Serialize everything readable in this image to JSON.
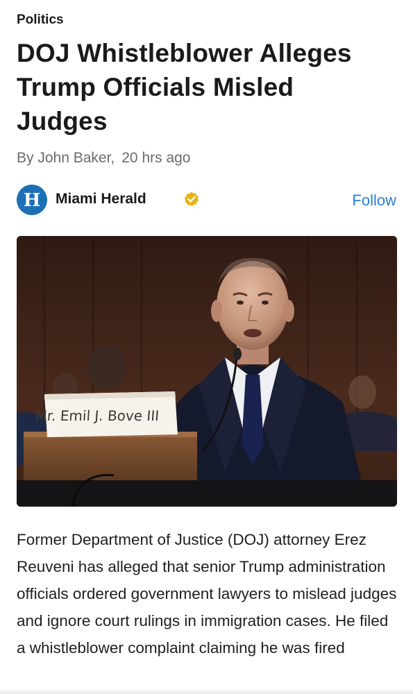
{
  "article": {
    "category": "Politics",
    "headline": "DOJ Whistleblower Alleges Trump Officials Misled Judges",
    "byline": {
      "author": "By John Baker,",
      "time": "20 hrs ago"
    },
    "source": {
      "name": "Miami Herald",
      "logo_letter": "H",
      "verified": true,
      "follow_label": "Follow"
    },
    "image": {
      "nameplate_text": "Mr. Emil J. Bove III"
    },
    "body": "Former Department of Justice (DOJ) attorney Erez Reuveni has alleged that senior Trump administration officials ordered government lawyers to mislead judges and ignore court rulings in immigration cases. He filed a whistleblower complaint claiming he was fired"
  },
  "colors": {
    "accent": "#2d7fd3",
    "logo_bg": "#1d6fb8",
    "verified_badge": "#e7b416",
    "byline": "#6b6b6b"
  },
  "icons": {
    "verified": "verified-badge-icon",
    "logo": "miami-herald-logo-icon"
  }
}
